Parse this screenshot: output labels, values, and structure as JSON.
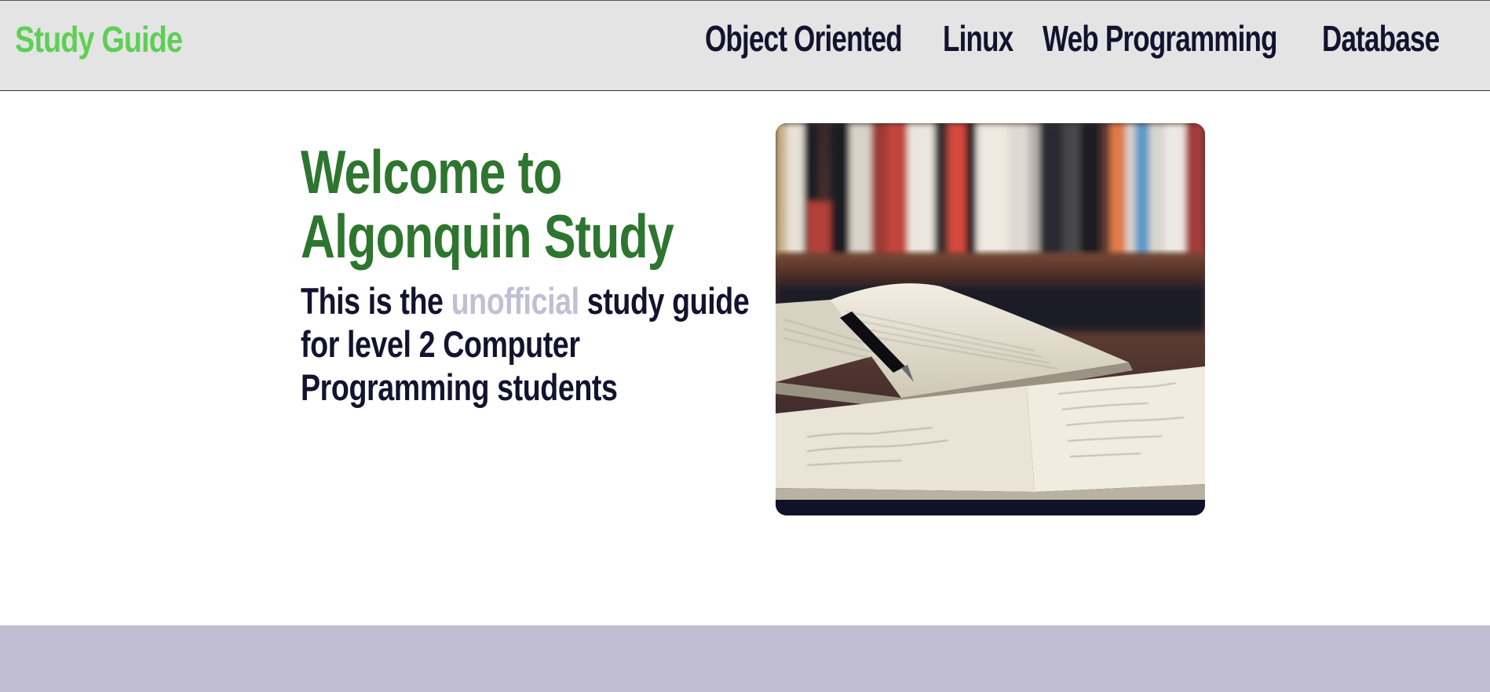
{
  "navbar": {
    "brand": "Study Guide",
    "links": [
      {
        "label": "Object Oriented"
      },
      {
        "label": "Linux"
      },
      {
        "label": "Web Programming"
      },
      {
        "label": "Database"
      }
    ]
  },
  "hero": {
    "title_line1": "Welcome to",
    "title_line2": "Algonquin Study",
    "subtitle_line1_before": "This is the ",
    "subtitle_highlight": "unofficial",
    "subtitle_line1_after": " study guide",
    "subtitle_line2": "for level 2 Computer",
    "subtitle_line3": "Programming students"
  },
  "colors": {
    "brand": "#5ecf55",
    "title": "#2e7530",
    "text": "#14122e",
    "highlight": "#c1bfd3",
    "navbar_bg": "#e4e4e4",
    "footer_bg": "#c1bdd3"
  }
}
